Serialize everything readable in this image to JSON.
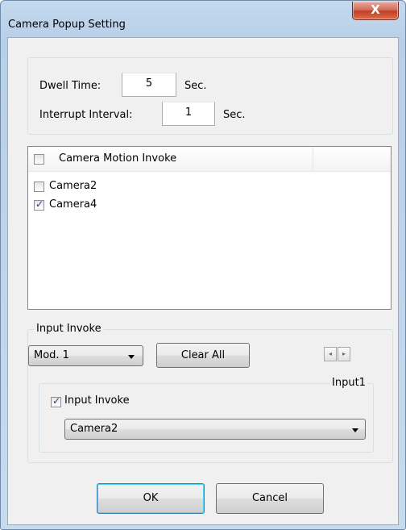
{
  "window": {
    "title": "Camera Popup Setting",
    "close_glyph": "X"
  },
  "timing": {
    "dwell_label": "Dwell Time:",
    "dwell_value": "5",
    "dwell_unit": "Sec.",
    "interrupt_label": "Interrupt Interval:",
    "interrupt_value": "1",
    "interrupt_unit": "Sec."
  },
  "motion_list": {
    "header_label": "Camera Motion Invoke",
    "header_checked": false,
    "items": [
      {
        "label": "Camera2",
        "checked": false
      },
      {
        "label": "Camera4",
        "checked": true
      }
    ]
  },
  "input_invoke": {
    "group_label": "Input Invoke",
    "module_value": "Mod. 1",
    "clear_all_label": "Clear All",
    "spin_left": "◂",
    "spin_right": "▸",
    "input_label": "Input1",
    "enable_label": "Input Invoke",
    "enable_checked": true,
    "camera_value": "Camera2"
  },
  "footer": {
    "ok_label": "OK",
    "cancel_label": "Cancel"
  }
}
